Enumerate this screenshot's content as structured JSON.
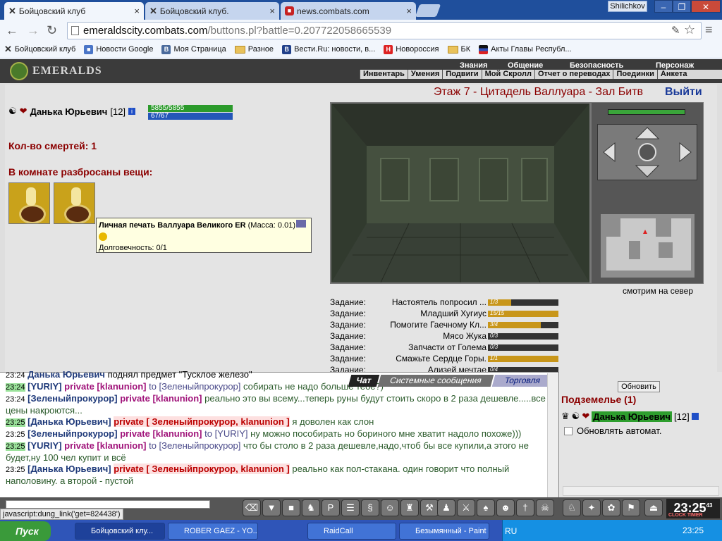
{
  "browser": {
    "tabs": [
      {
        "label": "Бойцовский клуб",
        "active": true
      },
      {
        "label": "Бойцовский клуб.",
        "active": false
      },
      {
        "label": "news.combats.com",
        "active": false
      }
    ],
    "user": "Shilichkov",
    "url_domain": "emeraldscity.combats.com",
    "url_path": "/buttons.pl?battle=0.207722058665539",
    "bookmarks": [
      "Бойцовский клуб",
      "Новости Google",
      "Моя Страница",
      "Разное",
      "Вести.Ru: новости, в...",
      "Новороссия",
      "БК",
      "Акты Главы Республ..."
    ]
  },
  "game": {
    "logo": "EMERALDS",
    "top_menu": [
      "Знания",
      "Общение",
      "Безопасность",
      "Персонаж"
    ],
    "sub_menu": [
      "Инвентарь",
      "Умения",
      "Подвиги",
      "Мой Скролл",
      "Отчет о переводах",
      "Поединки",
      "Анкета"
    ],
    "location": "Этаж 7 - Цитадель Валлуара - Зал Битв",
    "logout": "Выйти",
    "player": {
      "name": "Данька Юрьевич",
      "level": "[12]",
      "hp": "5855/5855",
      "mp": "67/67"
    },
    "deaths": "Кол-во смертей: 1",
    "items_header": "В комнате разбросаны вещи:",
    "tooltip": {
      "name": "Личная печать Валлуара Великого ER",
      "mass": " (Масса: 0.01)",
      "durability": "Долговечность: 0/1"
    },
    "look_direction": "смотрим на север",
    "quests": [
      {
        "label": "Задание:",
        "name": "Настоятель попросил ...",
        "progress": "1/3",
        "fill": 0.33
      },
      {
        "label": "Задание:",
        "name": "Младший Хугиус",
        "progress": "15/15",
        "fill": 1.0
      },
      {
        "label": "Задание:",
        "name": "Помогите Гаечному Кл...",
        "progress": "3/4",
        "fill": 0.75
      },
      {
        "label": "Задание:",
        "name": "Мясо Жука",
        "progress": "0/3",
        "fill": 0
      },
      {
        "label": "Задание:",
        "name": "Запчасти от Голема",
        "progress": "0/3",
        "fill": 0
      },
      {
        "label": "Задание:",
        "name": "Смажьте Сердце Горы.",
        "progress": "1/1",
        "fill": 1.0
      },
      {
        "label": "Задание:",
        "name": "Ализей мечтае",
        "progress": "0/4",
        "fill": 0
      }
    ]
  },
  "chat": {
    "tabs": [
      "Чат",
      "Системные сообщения",
      "Торговля"
    ],
    "lines": [
      {
        "time": "23:24",
        "pre": "",
        "who": "Данька Юрьевич",
        "priv": "",
        "to": "",
        "text": " поднял предмет \"Тусклое железо\""
      },
      {
        "time": "23:24",
        "pre": "[YURIY]",
        "who": "",
        "priv": "private [klanunion]",
        "to": " to [Зеленыйпрокурор]",
        "text": " собирать не надо больше тебе?)"
      },
      {
        "time": "23:24",
        "pre": "[Зеленыйпрокурор]",
        "who": "",
        "priv": "private [klanunion]",
        "to": "",
        "text": " реально это вы всему...теперь руны будут стоить скоро в 2 раза дешевле.....все цены накроются..."
      },
      {
        "time": "23:25",
        "pre": "[Данька Юрьевич]",
        "who": "",
        "priv": "private [ Зеленыйпрокурор, klanunion ]",
        "to": "",
        "text": " я доволен как слон"
      },
      {
        "time": "23:25",
        "pre": "[Зеленыйпрокурор]",
        "who": "",
        "priv": "private [klanunion]",
        "to": " to [YURIY]",
        "text": " ну можно пособирать но бориного мне хватит надоло похоже)))"
      },
      {
        "time": "23:25",
        "pre": "[YURIY]",
        "who": "",
        "priv": "private [klanunion]",
        "to": " to [Зеленыйпрокурор]",
        "text": " что бы столо в 2 раза дешевле,надо,чтоб бы все купили,а этого не будет,ну 100 чел купит и всё"
      },
      {
        "time": "23:25",
        "pre": "[Данька Юрьевич]",
        "who": "",
        "priv": "private [ Зеленыйпрокурор, klanunion ]",
        "to": "",
        "text": " реально как пол-стакана. один говорит что полный наполовину. а второй - пустой"
      }
    ]
  },
  "side": {
    "refresh": "Обновить",
    "dungeon": "Подземелье (1)",
    "player_name": "Данька Юрьевич",
    "player_level": "[12]",
    "auto_refresh": "Обновлять автомат."
  },
  "bottom": {
    "status": "javascript:dung_link('get=824438')",
    "clock": "23:25",
    "clock_seconds": "43",
    "clock_label": "CLOCK TIMER"
  },
  "taskbar": {
    "start": "Пуск",
    "items": [
      {
        "label": "Бойцовский клу...",
        "active": true
      },
      {
        "label": "ROBER GAEZ - YO...",
        "active": false
      },
      {
        "label": "RaidCall",
        "active": false
      },
      {
        "label": "Безымянный - Paint",
        "active": false
      }
    ],
    "lang": "RU",
    "time": "23:25"
  }
}
